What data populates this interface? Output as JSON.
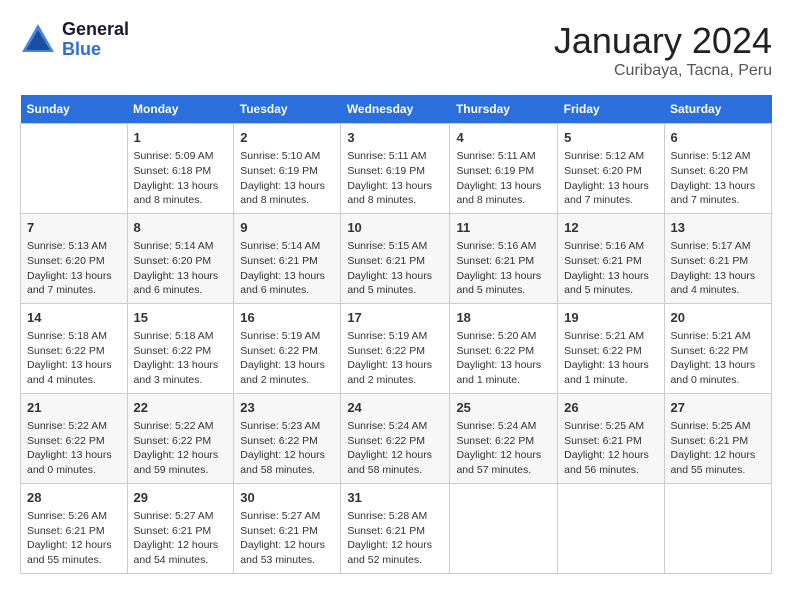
{
  "logo": {
    "line1": "General",
    "line2": "Blue"
  },
  "title": "January 2024",
  "location": "Curibaya, Tacna, Peru",
  "headers": [
    "Sunday",
    "Monday",
    "Tuesday",
    "Wednesday",
    "Thursday",
    "Friday",
    "Saturday"
  ],
  "weeks": [
    [
      {
        "day": "",
        "info": ""
      },
      {
        "day": "1",
        "info": "Sunrise: 5:09 AM\nSunset: 6:18 PM\nDaylight: 13 hours\nand 8 minutes."
      },
      {
        "day": "2",
        "info": "Sunrise: 5:10 AM\nSunset: 6:19 PM\nDaylight: 13 hours\nand 8 minutes."
      },
      {
        "day": "3",
        "info": "Sunrise: 5:11 AM\nSunset: 6:19 PM\nDaylight: 13 hours\nand 8 minutes."
      },
      {
        "day": "4",
        "info": "Sunrise: 5:11 AM\nSunset: 6:19 PM\nDaylight: 13 hours\nand 8 minutes."
      },
      {
        "day": "5",
        "info": "Sunrise: 5:12 AM\nSunset: 6:20 PM\nDaylight: 13 hours\nand 7 minutes."
      },
      {
        "day": "6",
        "info": "Sunrise: 5:12 AM\nSunset: 6:20 PM\nDaylight: 13 hours\nand 7 minutes."
      }
    ],
    [
      {
        "day": "7",
        "info": "Sunrise: 5:13 AM\nSunset: 6:20 PM\nDaylight: 13 hours\nand 7 minutes."
      },
      {
        "day": "8",
        "info": "Sunrise: 5:14 AM\nSunset: 6:20 PM\nDaylight: 13 hours\nand 6 minutes."
      },
      {
        "day": "9",
        "info": "Sunrise: 5:14 AM\nSunset: 6:21 PM\nDaylight: 13 hours\nand 6 minutes."
      },
      {
        "day": "10",
        "info": "Sunrise: 5:15 AM\nSunset: 6:21 PM\nDaylight: 13 hours\nand 5 minutes."
      },
      {
        "day": "11",
        "info": "Sunrise: 5:16 AM\nSunset: 6:21 PM\nDaylight: 13 hours\nand 5 minutes."
      },
      {
        "day": "12",
        "info": "Sunrise: 5:16 AM\nSunset: 6:21 PM\nDaylight: 13 hours\nand 5 minutes."
      },
      {
        "day": "13",
        "info": "Sunrise: 5:17 AM\nSunset: 6:21 PM\nDaylight: 13 hours\nand 4 minutes."
      }
    ],
    [
      {
        "day": "14",
        "info": "Sunrise: 5:18 AM\nSunset: 6:22 PM\nDaylight: 13 hours\nand 4 minutes."
      },
      {
        "day": "15",
        "info": "Sunrise: 5:18 AM\nSunset: 6:22 PM\nDaylight: 13 hours\nand 3 minutes."
      },
      {
        "day": "16",
        "info": "Sunrise: 5:19 AM\nSunset: 6:22 PM\nDaylight: 13 hours\nand 2 minutes."
      },
      {
        "day": "17",
        "info": "Sunrise: 5:19 AM\nSunset: 6:22 PM\nDaylight: 13 hours\nand 2 minutes."
      },
      {
        "day": "18",
        "info": "Sunrise: 5:20 AM\nSunset: 6:22 PM\nDaylight: 13 hours\nand 1 minute."
      },
      {
        "day": "19",
        "info": "Sunrise: 5:21 AM\nSunset: 6:22 PM\nDaylight: 13 hours\nand 1 minute."
      },
      {
        "day": "20",
        "info": "Sunrise: 5:21 AM\nSunset: 6:22 PM\nDaylight: 13 hours\nand 0 minutes."
      }
    ],
    [
      {
        "day": "21",
        "info": "Sunrise: 5:22 AM\nSunset: 6:22 PM\nDaylight: 13 hours\nand 0 minutes."
      },
      {
        "day": "22",
        "info": "Sunrise: 5:22 AM\nSunset: 6:22 PM\nDaylight: 12 hours\nand 59 minutes."
      },
      {
        "day": "23",
        "info": "Sunrise: 5:23 AM\nSunset: 6:22 PM\nDaylight: 12 hours\nand 58 minutes."
      },
      {
        "day": "24",
        "info": "Sunrise: 5:24 AM\nSunset: 6:22 PM\nDaylight: 12 hours\nand 58 minutes."
      },
      {
        "day": "25",
        "info": "Sunrise: 5:24 AM\nSunset: 6:22 PM\nDaylight: 12 hours\nand 57 minutes."
      },
      {
        "day": "26",
        "info": "Sunrise: 5:25 AM\nSunset: 6:21 PM\nDaylight: 12 hours\nand 56 minutes."
      },
      {
        "day": "27",
        "info": "Sunrise: 5:25 AM\nSunset: 6:21 PM\nDaylight: 12 hours\nand 55 minutes."
      }
    ],
    [
      {
        "day": "28",
        "info": "Sunrise: 5:26 AM\nSunset: 6:21 PM\nDaylight: 12 hours\nand 55 minutes."
      },
      {
        "day": "29",
        "info": "Sunrise: 5:27 AM\nSunset: 6:21 PM\nDaylight: 12 hours\nand 54 minutes."
      },
      {
        "day": "30",
        "info": "Sunrise: 5:27 AM\nSunset: 6:21 PM\nDaylight: 12 hours\nand 53 minutes."
      },
      {
        "day": "31",
        "info": "Sunrise: 5:28 AM\nSunset: 6:21 PM\nDaylight: 12 hours\nand 52 minutes."
      },
      {
        "day": "",
        "info": ""
      },
      {
        "day": "",
        "info": ""
      },
      {
        "day": "",
        "info": ""
      }
    ]
  ]
}
